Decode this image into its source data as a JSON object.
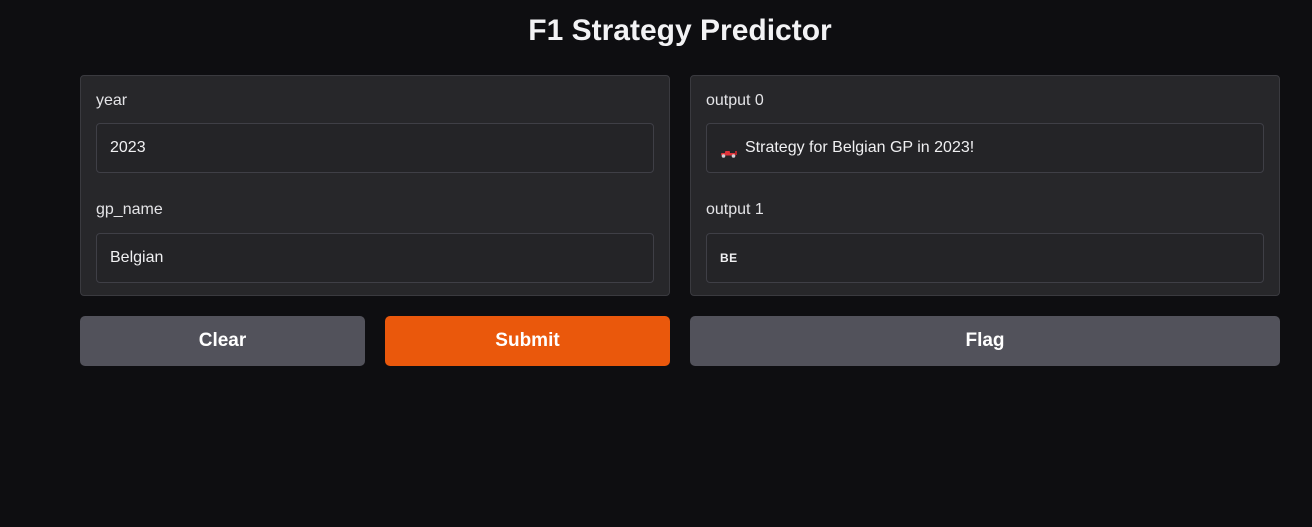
{
  "app": {
    "title": "F1 Strategy Predictor"
  },
  "inputs": {
    "year": {
      "label": "year",
      "value": "2023"
    },
    "gp_name": {
      "label": "gp_name",
      "value": "Belgian"
    }
  },
  "outputs": {
    "output0": {
      "label": "output 0",
      "icon": "race-car-icon",
      "value": "Strategy for Belgian GP in 2023!"
    },
    "output1": {
      "label": "output 1",
      "value": "BE"
    }
  },
  "buttons": {
    "clear": "Clear",
    "submit": "Submit",
    "flag": "Flag"
  },
  "colors": {
    "background": "#0e0e11",
    "panel": "#27272a",
    "submit": "#ea580c",
    "secondary_button": "#52525b"
  }
}
